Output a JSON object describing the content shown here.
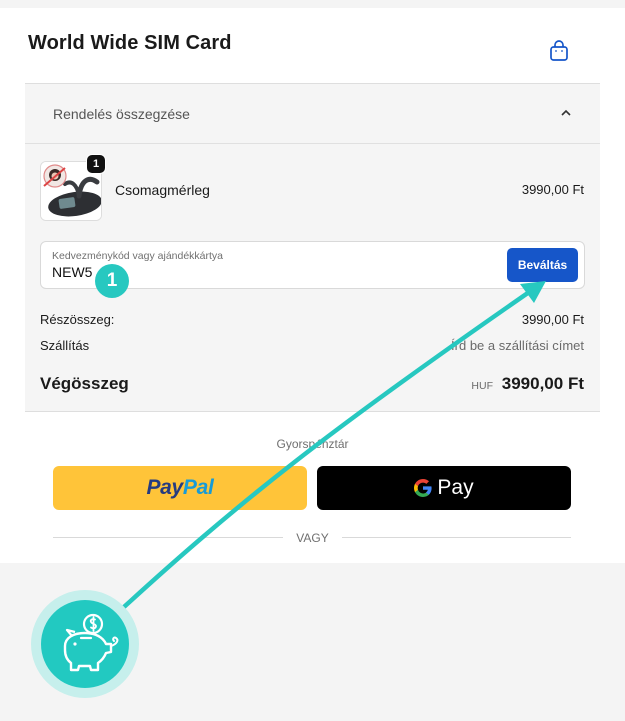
{
  "store": {
    "title": "World Wide SIM Card"
  },
  "icons": {
    "bag": "shopping-bag-icon",
    "chevron": "chevron-up-icon",
    "piggy": "piggy-bank-icon",
    "google": "google-g-icon"
  },
  "colors": {
    "accent": "#1656c9",
    "teal": "#27c8c0",
    "paypal_yellow": "#ffc439",
    "gpay_black": "#000000"
  },
  "summary": {
    "toggle_label": "Rendelés összegzése",
    "product": {
      "name": "Csomagmérleg",
      "price": "3990,00 Ft",
      "quantity": "1"
    },
    "discount": {
      "label": "Kedvezménykód vagy ajándékkártya",
      "value": "NEW5",
      "apply_label": "Beváltás"
    },
    "subtotal_label": "Részösszeg:",
    "subtotal_value": "3990,00 Ft",
    "shipping_label": "Szállítás",
    "shipping_value": "Írd be a szállítási címet",
    "total_label": "Végösszeg",
    "total_currency": "HUF",
    "total_value": "3990,00 Ft"
  },
  "express": {
    "label": "Gyorspénztár",
    "paypal_pay": "Pay",
    "paypal_pal": "Pal",
    "gpay_label": "Pay",
    "or_label": "VAGY"
  },
  "annotation": {
    "step_number": "1"
  }
}
